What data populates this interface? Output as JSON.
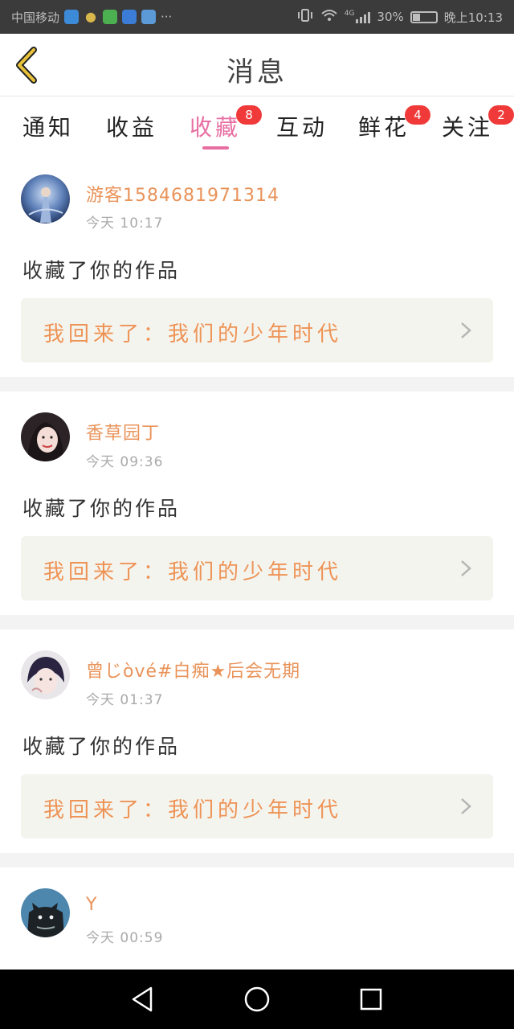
{
  "status_bar": {
    "carrier": "中国移动",
    "more": "···",
    "network_gen": "4G",
    "battery_text": "30%",
    "time": "晚上10:13"
  },
  "header": {
    "title": "消息"
  },
  "tabs": [
    {
      "label": "通知",
      "badge": ""
    },
    {
      "label": "收益",
      "badge": ""
    },
    {
      "label": "收藏",
      "badge": "8",
      "active": true
    },
    {
      "label": "互动",
      "badge": ""
    },
    {
      "label": "鲜花",
      "badge": "4"
    },
    {
      "label": "关注",
      "badge": "2"
    }
  ],
  "items": [
    {
      "username": "游客15846819713​14",
      "time": "今天 10:17",
      "action": "收藏了你的作品",
      "work_title": "我回来了：我们的少年时代"
    },
    {
      "username": "香草园丁",
      "time": "今天 09:36",
      "action": "收藏了你的作品",
      "work_title": "我回来了：我们的少年时代"
    },
    {
      "username": "曾じòvé#白痴★后会无期",
      "time": "今天 01:37",
      "action": "收藏了你的作品",
      "work_title": "我回来了：我们的少年时代"
    },
    {
      "username": "Y",
      "time": "今天 00:59",
      "action": "",
      "work_title": ""
    }
  ],
  "colors": {
    "accent_pink": "#e86ea2",
    "username_orange": "#e9935a",
    "work_orange": "#ee9356",
    "badge_red": "#f03a3a",
    "back_arrow": "#e8c23a"
  }
}
